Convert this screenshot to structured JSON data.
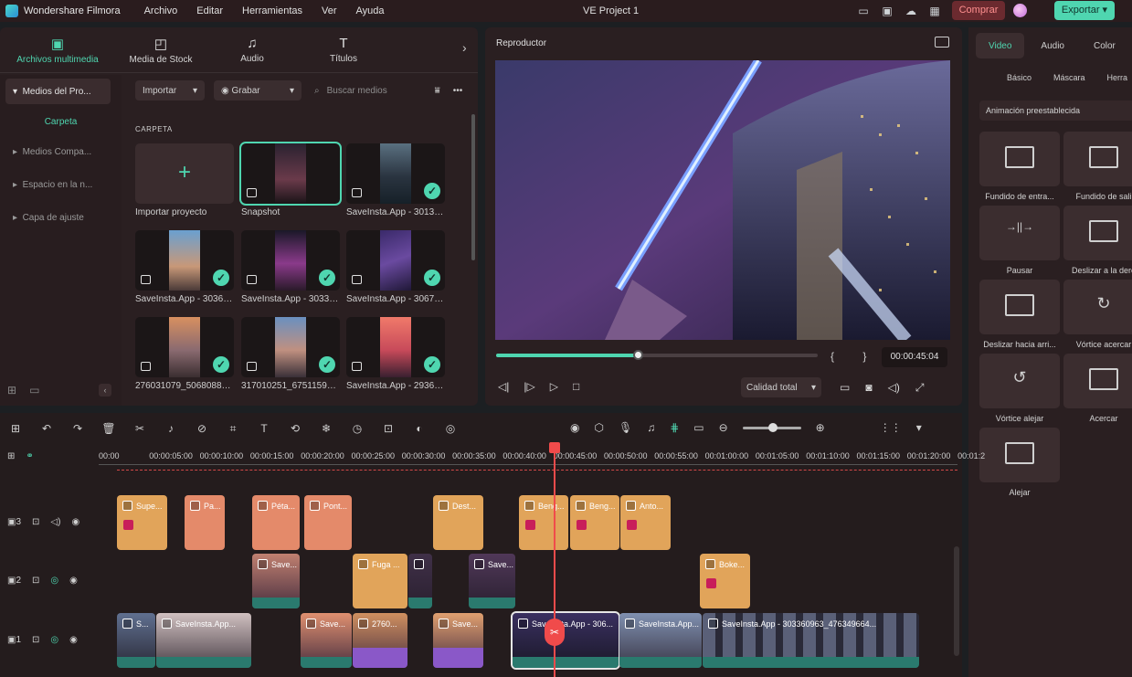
{
  "menubar": {
    "app_name": "Wondershare Filmora",
    "items": [
      "Archivo",
      "Editar",
      "Herramientas",
      "Ver",
      "Ayuda"
    ],
    "project_title": "VE Project 1",
    "buy_label": "Comprar",
    "export_label": "Exportar"
  },
  "media": {
    "tabs": [
      {
        "label": "Archivos multimedia",
        "icon": "media-files-icon"
      },
      {
        "label": "Media de Stock",
        "icon": "stock-media-icon"
      },
      {
        "label": "Audio",
        "icon": "music-note-icon"
      },
      {
        "label": "Títulos",
        "icon": "title-text-icon"
      }
    ],
    "sidebar": {
      "project_media": "Medios del Pro...",
      "folder": "Carpeta",
      "shared_media": "Medios Compa...",
      "cloud_space": "Espacio en la n...",
      "adjustment_layer": "Capa de ajuste"
    },
    "import_dropdown": "Importar",
    "record_dropdown": "Grabar",
    "search_placeholder": "Buscar medios",
    "section_label": "CARPETA",
    "items": [
      {
        "label": "Importar proyecto"
      },
      {
        "label": "Snapshot"
      },
      {
        "label": "SaveInsta.App - 30135..."
      },
      {
        "label": "SaveInsta.App - 30360..."
      },
      {
        "label": "SaveInsta.App - 30335..."
      },
      {
        "label": "SaveInsta.App - 30675..."
      },
      {
        "label": "276031079_506808823..."
      },
      {
        "label": "317010251_675115960..."
      },
      {
        "label": "SaveInsta.App - 29366..."
      }
    ]
  },
  "player": {
    "title": "Reproductor",
    "progress": 0.44,
    "in_out": "{ }",
    "timecode": "00:00:45:04",
    "quality": "Calidad total"
  },
  "props": {
    "tabs": [
      "Video",
      "Audio",
      "Color"
    ],
    "subtabs": [
      "Básico",
      "Máscara",
      "Herra"
    ],
    "preset_dropdown": "Animación preestablecida",
    "animations": [
      "Fundido de entra...",
      "Fundido de sali",
      "Pausar",
      "Deslizar a la dere",
      "Deslizar hacia arri...",
      "Vórtice acercar",
      "Vórtice alejar",
      "Acercar",
      "Alejar"
    ]
  },
  "timeline": {
    "ruler": [
      "00:00",
      "00:00:05:00",
      "00:00:10:00",
      "00:00:15:00",
      "00:00:20:00",
      "00:00:25:00",
      "00:00:30:00",
      "00:00:35:00",
      "00:00:40:00",
      "00:00:45:00",
      "00:00:50:00",
      "00:00:55:00",
      "00:01:00:00",
      "00:01:05:00",
      "00:01:10:00",
      "00:01:15:00",
      "00:01:20:00",
      "00:01:2"
    ],
    "track_labels": [
      "3",
      "2",
      "1"
    ],
    "track3": [
      "Supe...",
      "Pa...",
      "Péta...",
      "Pont...",
      "Dest...",
      "Beng...",
      "Beng...",
      "Anto..."
    ],
    "track2": [
      "Save...",
      "Fuga ...",
      "Save...",
      "Boke..."
    ],
    "track1": [
      "S...",
      "SaveInsta.App...",
      "Save...",
      "2760...",
      "Save...",
      "SaveInsta.App - 306...",
      "SaveInsta.App...",
      "SaveInsta.App - 303360963_476349664..."
    ]
  },
  "colors": {
    "accent": "#4fd6b0",
    "buy": "#ff8f8f",
    "playhead": "#f04b4b",
    "effect_clip": "#e1a45a",
    "sticker_clip": "#e48a6a"
  }
}
